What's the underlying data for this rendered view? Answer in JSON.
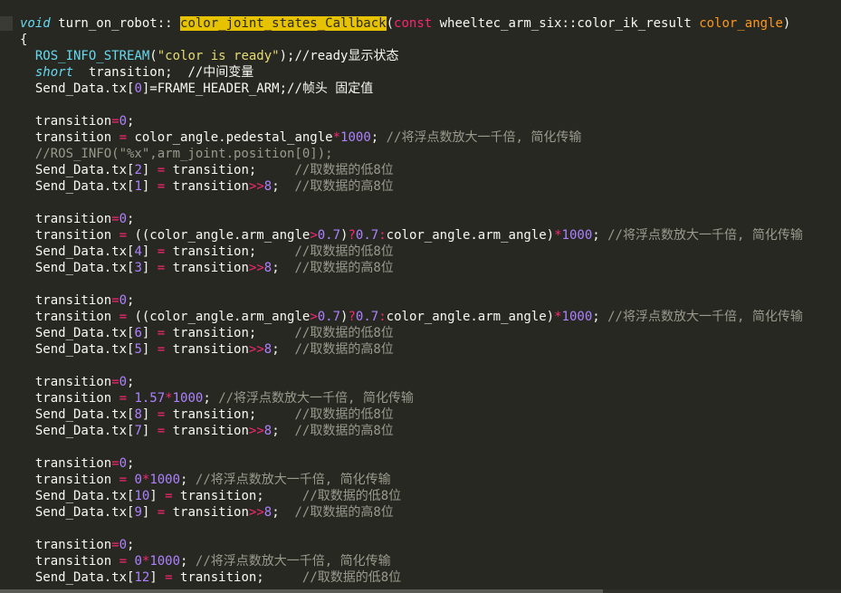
{
  "editor": {
    "lines": [
      [
        {
          "t": "void",
          "c": "type"
        },
        {
          "t": " turn_on_robot:: "
        },
        {
          "t": "color_joint_states_Callback",
          "c": "highlight"
        },
        {
          "t": "("
        },
        {
          "t": "const",
          "c": "keyword"
        },
        {
          "t": " wheeltec_arm_six::color_ik_result "
        },
        {
          "t": "color_angle",
          "c": "param"
        },
        {
          "t": ")"
        }
      ],
      [
        {
          "t": "{"
        }
      ],
      [
        {
          "t": "  "
        },
        {
          "t": "ROS_INFO_STREAM",
          "c": "func"
        },
        {
          "t": "("
        },
        {
          "t": "\"color is ready\"",
          "c": "string"
        },
        {
          "t": ");//ready显示状态"
        }
      ],
      [
        {
          "t": "  "
        },
        {
          "t": "short",
          "c": "type"
        },
        {
          "t": "  transition;  //中间变量"
        }
      ],
      [
        {
          "t": "  Send_Data.tx["
        },
        {
          "t": "0",
          "c": "number"
        },
        {
          "t": "]=FRAME_HEADER_ARM;//帧头 固定值"
        }
      ],
      [
        {
          "t": ""
        }
      ],
      [
        {
          "t": "  transition"
        },
        {
          "t": "=",
          "c": "op"
        },
        {
          "t": "0",
          "c": "number"
        },
        {
          "t": ";"
        }
      ],
      [
        {
          "t": "  transition "
        },
        {
          "t": "=",
          "c": "op"
        },
        {
          "t": " color_angle.pedestal_angle"
        },
        {
          "t": "*",
          "c": "op"
        },
        {
          "t": "1000",
          "c": "number"
        },
        {
          "t": "; "
        },
        {
          "t": "//将浮点数放大一千倍, 简化传输",
          "c": "comment"
        }
      ],
      [
        {
          "t": "  //ROS_INFO(\"%x\",arm_joint.position[0]);",
          "c": "comment"
        }
      ],
      [
        {
          "t": "  Send_Data.tx["
        },
        {
          "t": "2",
          "c": "number"
        },
        {
          "t": "] "
        },
        {
          "t": "=",
          "c": "op"
        },
        {
          "t": " transition;     "
        },
        {
          "t": "//取数据的低8位",
          "c": "comment"
        }
      ],
      [
        {
          "t": "  Send_Data.tx["
        },
        {
          "t": "1",
          "c": "number"
        },
        {
          "t": "] "
        },
        {
          "t": "=",
          "c": "op"
        },
        {
          "t": " transition"
        },
        {
          "t": ">>",
          "c": "op"
        },
        {
          "t": "8",
          "c": "number"
        },
        {
          "t": ";  "
        },
        {
          "t": "//取数据的高8位",
          "c": "comment"
        }
      ],
      [
        {
          "t": ""
        }
      ],
      [
        {
          "t": "  transition"
        },
        {
          "t": "=",
          "c": "op"
        },
        {
          "t": "0",
          "c": "number"
        },
        {
          "t": ";"
        }
      ],
      [
        {
          "t": "  transition "
        },
        {
          "t": "=",
          "c": "op"
        },
        {
          "t": " ((color_angle.arm_angle"
        },
        {
          "t": ">",
          "c": "op"
        },
        {
          "t": "0.7",
          "c": "number"
        },
        {
          "t": ")"
        },
        {
          "t": "?",
          "c": "op"
        },
        {
          "t": "0.7",
          "c": "number"
        },
        {
          "t": ":",
          "c": "op"
        },
        {
          "t": "color_angle.arm_angle)"
        },
        {
          "t": "*",
          "c": "op"
        },
        {
          "t": "1000",
          "c": "number"
        },
        {
          "t": "; "
        },
        {
          "t": "//将浮点数放大一千倍, 简化传输",
          "c": "comment"
        }
      ],
      [
        {
          "t": "  Send_Data.tx["
        },
        {
          "t": "4",
          "c": "number"
        },
        {
          "t": "] "
        },
        {
          "t": "=",
          "c": "op"
        },
        {
          "t": " transition;     "
        },
        {
          "t": "//取数据的低8位",
          "c": "comment"
        }
      ],
      [
        {
          "t": "  Send_Data.tx["
        },
        {
          "t": "3",
          "c": "number"
        },
        {
          "t": "] "
        },
        {
          "t": "=",
          "c": "op"
        },
        {
          "t": " transition"
        },
        {
          "t": ">>",
          "c": "op"
        },
        {
          "t": "8",
          "c": "number"
        },
        {
          "t": ";  "
        },
        {
          "t": "//取数据的高8位",
          "c": "comment"
        }
      ],
      [
        {
          "t": ""
        }
      ],
      [
        {
          "t": "  transition"
        },
        {
          "t": "=",
          "c": "op"
        },
        {
          "t": "0",
          "c": "number"
        },
        {
          "t": ";"
        }
      ],
      [
        {
          "t": "  transition "
        },
        {
          "t": "=",
          "c": "op"
        },
        {
          "t": " ((color_angle.arm_angle"
        },
        {
          "t": ">",
          "c": "op"
        },
        {
          "t": "0.7",
          "c": "number"
        },
        {
          "t": ")"
        },
        {
          "t": "?",
          "c": "op"
        },
        {
          "t": "0.7",
          "c": "number"
        },
        {
          "t": ":",
          "c": "op"
        },
        {
          "t": "color_angle.arm_angle)"
        },
        {
          "t": "*",
          "c": "op"
        },
        {
          "t": "1000",
          "c": "number"
        },
        {
          "t": "; "
        },
        {
          "t": "//将浮点数放大一千倍, 简化传输",
          "c": "comment"
        }
      ],
      [
        {
          "t": "  Send_Data.tx["
        },
        {
          "t": "6",
          "c": "number"
        },
        {
          "t": "] "
        },
        {
          "t": "=",
          "c": "op"
        },
        {
          "t": " transition;     "
        },
        {
          "t": "//取数据的低8位",
          "c": "comment"
        }
      ],
      [
        {
          "t": "  Send_Data.tx["
        },
        {
          "t": "5",
          "c": "number"
        },
        {
          "t": "] "
        },
        {
          "t": "=",
          "c": "op"
        },
        {
          "t": " transition"
        },
        {
          "t": ">>",
          "c": "op"
        },
        {
          "t": "8",
          "c": "number"
        },
        {
          "t": ";  "
        },
        {
          "t": "//取数据的高8位",
          "c": "comment"
        }
      ],
      [
        {
          "t": ""
        }
      ],
      [
        {
          "t": "  transition"
        },
        {
          "t": "=",
          "c": "op"
        },
        {
          "t": "0",
          "c": "number"
        },
        {
          "t": ";"
        }
      ],
      [
        {
          "t": "  transition "
        },
        {
          "t": "=",
          "c": "op"
        },
        {
          "t": " "
        },
        {
          "t": "1.57",
          "c": "number"
        },
        {
          "t": "*",
          "c": "op"
        },
        {
          "t": "1000",
          "c": "number"
        },
        {
          "t": "; "
        },
        {
          "t": "//将浮点数放大一千倍, 简化传输",
          "c": "comment"
        }
      ],
      [
        {
          "t": "  Send_Data.tx["
        },
        {
          "t": "8",
          "c": "number"
        },
        {
          "t": "] "
        },
        {
          "t": "=",
          "c": "op"
        },
        {
          "t": " transition;     "
        },
        {
          "t": "//取数据的低8位",
          "c": "comment"
        }
      ],
      [
        {
          "t": "  Send_Data.tx["
        },
        {
          "t": "7",
          "c": "number"
        },
        {
          "t": "] "
        },
        {
          "t": "=",
          "c": "op"
        },
        {
          "t": " transition"
        },
        {
          "t": ">>",
          "c": "op"
        },
        {
          "t": "8",
          "c": "number"
        },
        {
          "t": ";  "
        },
        {
          "t": "//取数据的高8位",
          "c": "comment"
        }
      ],
      [
        {
          "t": ""
        }
      ],
      [
        {
          "t": "  transition"
        },
        {
          "t": "=",
          "c": "op"
        },
        {
          "t": "0",
          "c": "number"
        },
        {
          "t": ";"
        }
      ],
      [
        {
          "t": "  transition "
        },
        {
          "t": "=",
          "c": "op"
        },
        {
          "t": " "
        },
        {
          "t": "0",
          "c": "number"
        },
        {
          "t": "*",
          "c": "op"
        },
        {
          "t": "1000",
          "c": "number"
        },
        {
          "t": "; "
        },
        {
          "t": "//将浮点数放大一千倍, 简化传输",
          "c": "comment"
        }
      ],
      [
        {
          "t": "  Send_Data.tx["
        },
        {
          "t": "10",
          "c": "number"
        },
        {
          "t": "] "
        },
        {
          "t": "=",
          "c": "op"
        },
        {
          "t": " transition;     "
        },
        {
          "t": "//取数据的低8位",
          "c": "comment"
        }
      ],
      [
        {
          "t": "  Send_Data.tx["
        },
        {
          "t": "9",
          "c": "number"
        },
        {
          "t": "] "
        },
        {
          "t": "=",
          "c": "op"
        },
        {
          "t": " transition"
        },
        {
          "t": ">>",
          "c": "op"
        },
        {
          "t": "8",
          "c": "number"
        },
        {
          "t": ";  "
        },
        {
          "t": "//取数据的高8位",
          "c": "comment"
        }
      ],
      [
        {
          "t": ""
        }
      ],
      [
        {
          "t": "  transition"
        },
        {
          "t": "=",
          "c": "op"
        },
        {
          "t": "0",
          "c": "number"
        },
        {
          "t": ";"
        }
      ],
      [
        {
          "t": "  transition "
        },
        {
          "t": "=",
          "c": "op"
        },
        {
          "t": " "
        },
        {
          "t": "0",
          "c": "number"
        },
        {
          "t": "*",
          "c": "op"
        },
        {
          "t": "1000",
          "c": "number"
        },
        {
          "t": "; "
        },
        {
          "t": "//将浮点数放大一千倍, 简化传输",
          "c": "comment"
        }
      ],
      [
        {
          "t": "  Send_Data.tx["
        },
        {
          "t": "12",
          "c": "number"
        },
        {
          "t": "] "
        },
        {
          "t": "=",
          "c": "op"
        },
        {
          "t": " transition;     "
        },
        {
          "t": "//取数据的低8位",
          "c": "comment"
        }
      ]
    ]
  },
  "colors": {
    "background": "#272822",
    "text": "#f8f8f2",
    "keyword": "#f92672",
    "type": "#66d9ef",
    "string": "#e6db74",
    "number": "#ae81ff",
    "comment": "#9a9a8c",
    "parameter": "#fd971f",
    "search_highlight": "#e6c200"
  }
}
